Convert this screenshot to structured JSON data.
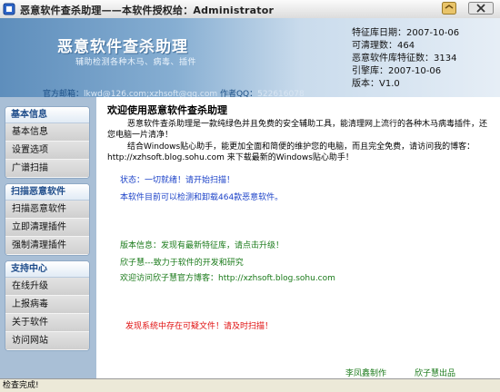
{
  "window": {
    "title": "恶意软件查杀助理——本软件授权给：Administrator"
  },
  "header": {
    "logo_title": "恶意软件查杀助理",
    "slogan": "辅助检测各种木马、病毒、插件",
    "contact": {
      "email_label": "官方邮箱：",
      "email": "lkwd@126.com;xzhsoft@qq.com",
      "qq_label": "作者QQ：",
      "qq": "522616078"
    },
    "info": [
      {
        "label": "特征库日期",
        "value": "2007-10-06"
      },
      {
        "label": "可清理数",
        "value": "464"
      },
      {
        "label": "恶意软件库特征数",
        "value": "3134"
      },
      {
        "label": "引擎库",
        "value": "2007-10-06"
      },
      {
        "label": "版本",
        "value": "V1.0"
      }
    ]
  },
  "sidebar": {
    "groups": [
      {
        "title": "基本信息",
        "items": [
          "基本信息",
          "设置选项",
          "广谱扫描"
        ]
      },
      {
        "title": "扫描恶意软件",
        "items": [
          "扫描恶意软件",
          "立即清理插件",
          "强制清理插件"
        ]
      },
      {
        "title": "支持中心",
        "items": [
          "在线升级",
          "上报病毒",
          "关于软件",
          "访问网站"
        ]
      }
    ]
  },
  "content": {
    "welcome": "欢迎使用恶意软件查杀助理",
    "intro": "恶意软件查杀助理是一款纯绿色并且免费的安全辅助工具，能清理网上流行的各种木马病毒插件，还您电脑一片清净！",
    "intro2": "结合Windows贴心助手，能更加全面和简便的维护您的电脑，而且完全免费，请访问我的博客：http://xzhsoft.blog.sohu.com 来下载最新的Windows贴心助手！",
    "status": "状态：一切就绪！请开始扫描！",
    "count_text": "本软件目前可以检测和卸载464款恶意软件。",
    "version_info": "版本信息：发现有最新特征库，请点击升级！",
    "thanks": "欣子慧---致力于软件的开发和研究",
    "blog_text": "欢迎访问欣子慧官方博客：http://xzhsoft.blog.sohu.com",
    "alert": "发现系统中存在可疑文件！请及时扫描！",
    "author_left": "李凤鑫制作",
    "author_right": "欣子慧出品"
  },
  "statusbar": {
    "text": "检查完成!"
  },
  "colors": {
    "header_gradient_start": "#5e8ebc",
    "header_gradient_end": "#e6eef6",
    "sidebar_bg": "#a9bfd6",
    "link_blue": "#1d43c8",
    "text_green": "#1a7a1a",
    "alert_red": "#e01010"
  },
  "icons": {
    "app": "app-icon",
    "minimize": "minimize-icon",
    "close": "close-icon"
  }
}
